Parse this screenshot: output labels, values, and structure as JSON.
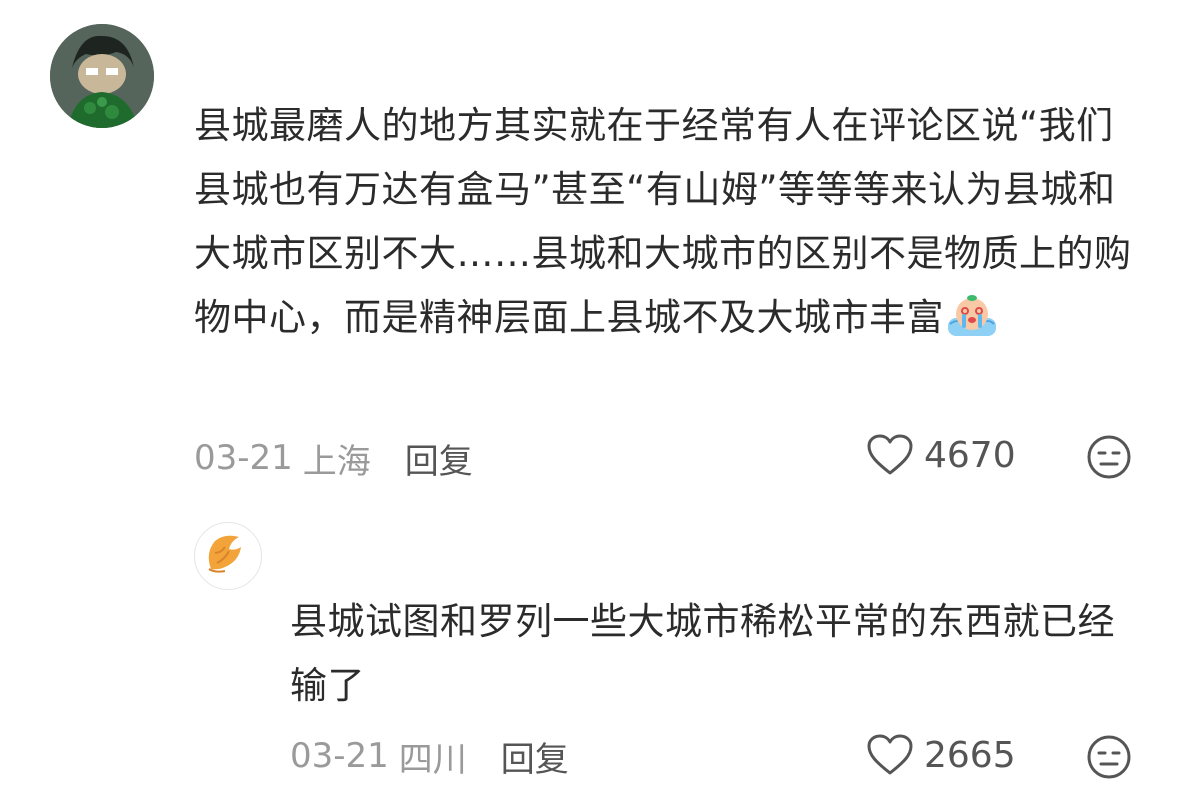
{
  "comments": [
    {
      "avatar_icon": "user-avatar-icon",
      "text": "县城最磨人的地方其实就在于经常有人在评论区说“我们县城也有万达有盒马”甚至“有山姆”等等等来认为县城和大城市区别不大……县城和大城市的区别不是物质上的购物中心，而是精神层面上县城不及大城市丰富",
      "emoji_icon": "crying-face-emoji-icon",
      "date": "03-21",
      "location": "上海",
      "reply_label": "回复",
      "likes": "4670"
    },
    {
      "avatar_icon": "croissant-avatar-icon",
      "text": "县城试图和罗列一些大城市稀松平常的东西就已经输了",
      "date": "03-21",
      "location": "四川",
      "reply_label": "回复",
      "likes": "2665"
    }
  ],
  "colors": {
    "text": "#2b2b2b",
    "meta": "#9a9a9a",
    "icon": "#555555",
    "croissant": "#f2a33a"
  }
}
